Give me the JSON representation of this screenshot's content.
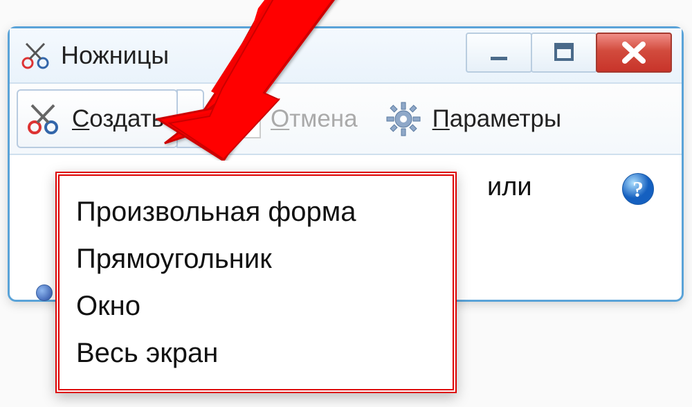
{
  "window": {
    "title": "Ножницы"
  },
  "toolbar": {
    "new_label_underline": "С",
    "new_label_rest": "оздать",
    "cancel_label_underline": "О",
    "cancel_label_rest": "тмена",
    "options_label_underline": "П",
    "options_label_rest": "араметры"
  },
  "partial_visible_text": "или",
  "dropdown": {
    "items": [
      "Произвольная форма",
      "Прямоугольник",
      "Окно",
      "Весь экран"
    ]
  }
}
